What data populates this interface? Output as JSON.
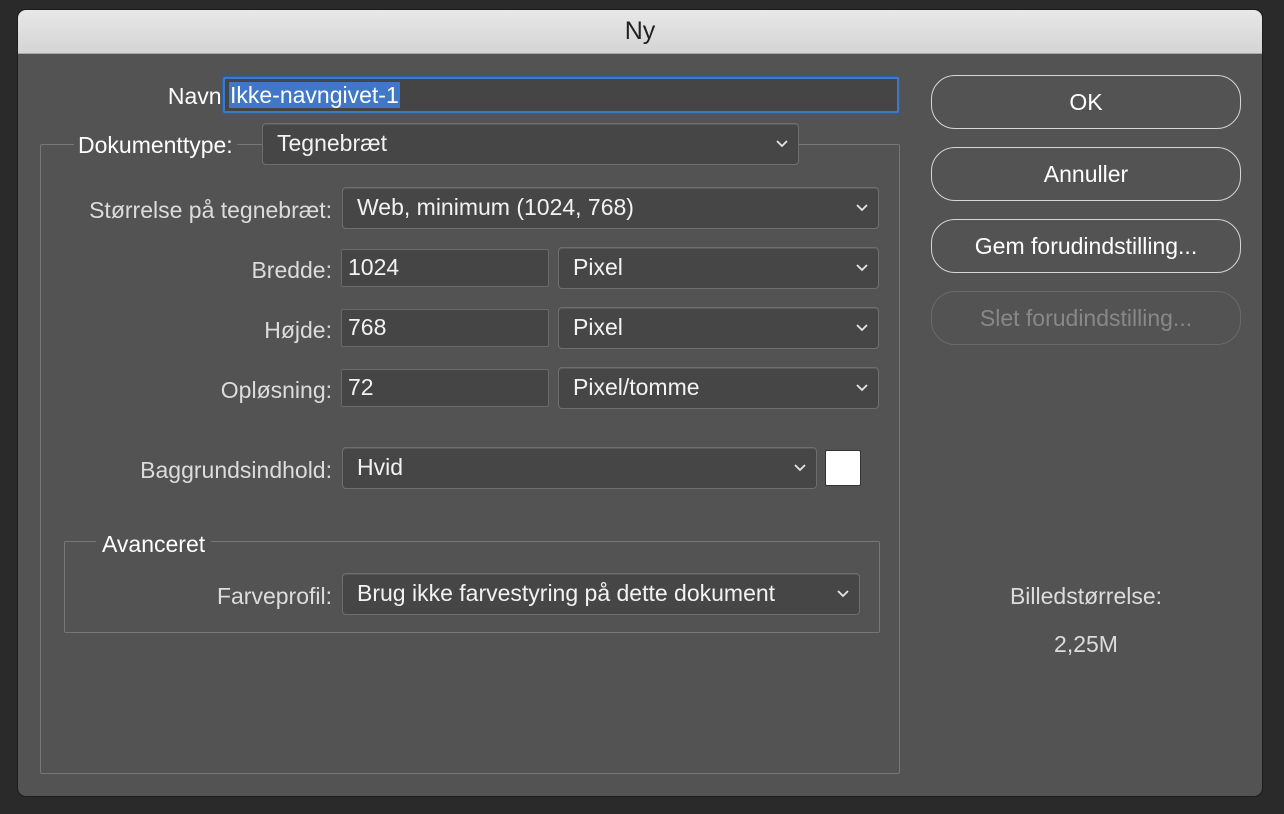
{
  "window": {
    "title": "Ny"
  },
  "name": {
    "label": "Navn:",
    "value": "Ikke-navngivet-1"
  },
  "document_type": {
    "label": "Dokumenttype:",
    "value": "Tegnebræt"
  },
  "artboard_size": {
    "label": "Størrelse på tegnebræt:",
    "value": "Web, minimum (1024, 768)"
  },
  "width": {
    "label": "Bredde:",
    "value": "1024",
    "unit": "Pixel"
  },
  "height": {
    "label": "Højde:",
    "value": "768",
    "unit": "Pixel"
  },
  "resolution": {
    "label": "Opløsning:",
    "value": "72",
    "unit": "Pixel/tomme"
  },
  "background": {
    "label": "Baggrundsindhold:",
    "value": "Hvid",
    "swatch_color": "#ffffff"
  },
  "advanced": {
    "title": "Avanceret",
    "color_profile_label": "Farveprofil:",
    "color_profile_value": "Brug ikke farvestyring på dette dokument"
  },
  "buttons": {
    "ok": "OK",
    "cancel": "Annuller",
    "save_preset": "Gem forudindstilling...",
    "delete_preset": "Slet forudindstilling..."
  },
  "image_size": {
    "label": "Billedstørrelse:",
    "value": "2,25M"
  },
  "icons": {
    "dropdown": "chevron-down-icon"
  }
}
